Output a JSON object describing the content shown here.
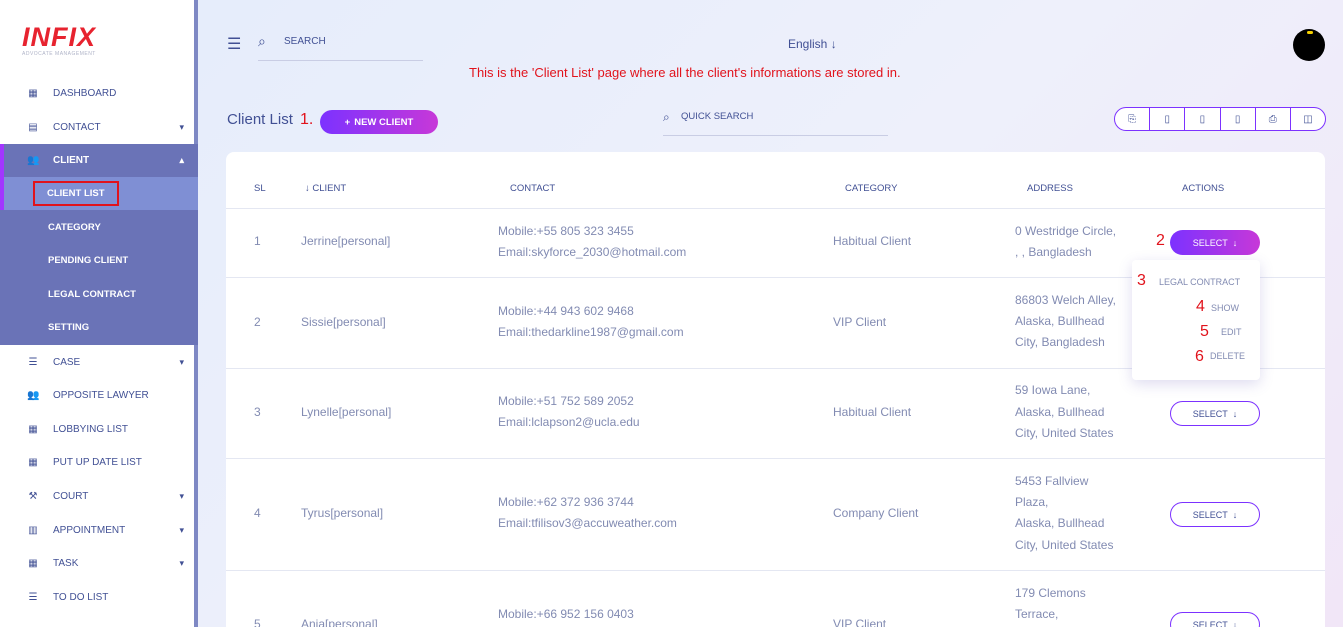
{
  "app": {
    "logo": "INFIX",
    "logo_sub": "ADVOCATE MANAGEMENT"
  },
  "sidebar": {
    "items": [
      {
        "label": "DASHBOARD",
        "icon": "grid-icon"
      },
      {
        "label": "CONTACT",
        "icon": "contact-book-icon",
        "chevron": "▾"
      },
      {
        "label": "CLIENT",
        "icon": "users-icon",
        "chevron": "▴",
        "active": true
      },
      {
        "label": "CASE",
        "icon": "list-icon",
        "chevron": "▾"
      },
      {
        "label": "OPPOSITE LAWYER",
        "icon": "users-icon"
      },
      {
        "label": "LOBBYING LIST",
        "icon": "grid-icon"
      },
      {
        "label": "PUT UP DATE LIST",
        "icon": "grid-icon"
      },
      {
        "label": "COURT",
        "icon": "gavel-icon",
        "chevron": "▾"
      },
      {
        "label": "APPOINTMENT",
        "icon": "calendar-icon",
        "chevron": "▾"
      },
      {
        "label": "TASK",
        "icon": "grid-icon",
        "chevron": "▾"
      },
      {
        "label": "TO DO LIST",
        "icon": "list-icon"
      }
    ],
    "client_submenu": [
      "CLIENT LIST",
      "CATEGORY",
      "PENDING CLIENT",
      "LEGAL CONTRACT",
      "SETTING"
    ]
  },
  "header": {
    "search_placeholder": "SEARCH",
    "language": "English ↓",
    "annotation": "This is the 'Client List' page where all the client's informations are stored in."
  },
  "toolbar": {
    "title": "Client List",
    "new_client_label": "NEW CLIENT",
    "quick_search_placeholder": "QUICK SEARCH",
    "export_icons": [
      "copy-icon",
      "excel-icon",
      "csv-icon",
      "pdf-icon",
      "print-icon",
      "columns-icon"
    ]
  },
  "annotations": {
    "n1": "1.",
    "n2": "2",
    "n3": "3",
    "n4": "4",
    "n5": "5",
    "n6": "6"
  },
  "table": {
    "headers": {
      "sl": "SL",
      "client": "↓ CLIENT",
      "contact": "CONTACT",
      "category": "CATEGORY",
      "address": "ADDRESS",
      "actions": "ACTIONS"
    },
    "select_label": "SELECT",
    "rows": [
      {
        "sl": "1",
        "client": "Jerrine[personal]",
        "mobile": "Mobile:+55 805 323 3455",
        "email": "Email:skyforce_2030@hotmail.com",
        "category": "Habitual Client",
        "address": [
          "0 Westridge Circle,",
          ", , Bangladesh"
        ]
      },
      {
        "sl": "2",
        "client": "Sissie[personal]",
        "mobile": "Mobile:+44 943 602 9468",
        "email": "Email:thedarkline1987@gmail.com",
        "category": "VIP Client",
        "address": [
          "86803 Welch Alley,",
          "Alaska, Bullhead",
          "City, Bangladesh"
        ]
      },
      {
        "sl": "3",
        "client": "Lynelle[personal]",
        "mobile": "Mobile:+51 752 589 2052",
        "email": "Email:lclapson2@ucla.edu",
        "category": "Habitual Client",
        "address": [
          "59 Iowa Lane,",
          "Alaska, Bullhead",
          "City, United States"
        ]
      },
      {
        "sl": "4",
        "client": "Tyrus[personal]",
        "mobile": "Mobile:+62 372 936 3744",
        "email": "Email:tfilisov3@accuweather.com",
        "category": "Company Client",
        "address": [
          "5453 Fallview",
          "Plaza,",
          "Alaska, Bullhead",
          "City, United States"
        ]
      },
      {
        "sl": "5",
        "client": "Anja[personal]",
        "mobile": "Mobile:+66 952 156 0403",
        "email": "",
        "category": "VIP Client",
        "address": [
          "179 Clemons",
          "Terrace,"
        ]
      }
    ]
  },
  "dropdown": {
    "items": [
      "LEGAL CONTRACT",
      "SHOW",
      "EDIT",
      "DELETE"
    ]
  }
}
